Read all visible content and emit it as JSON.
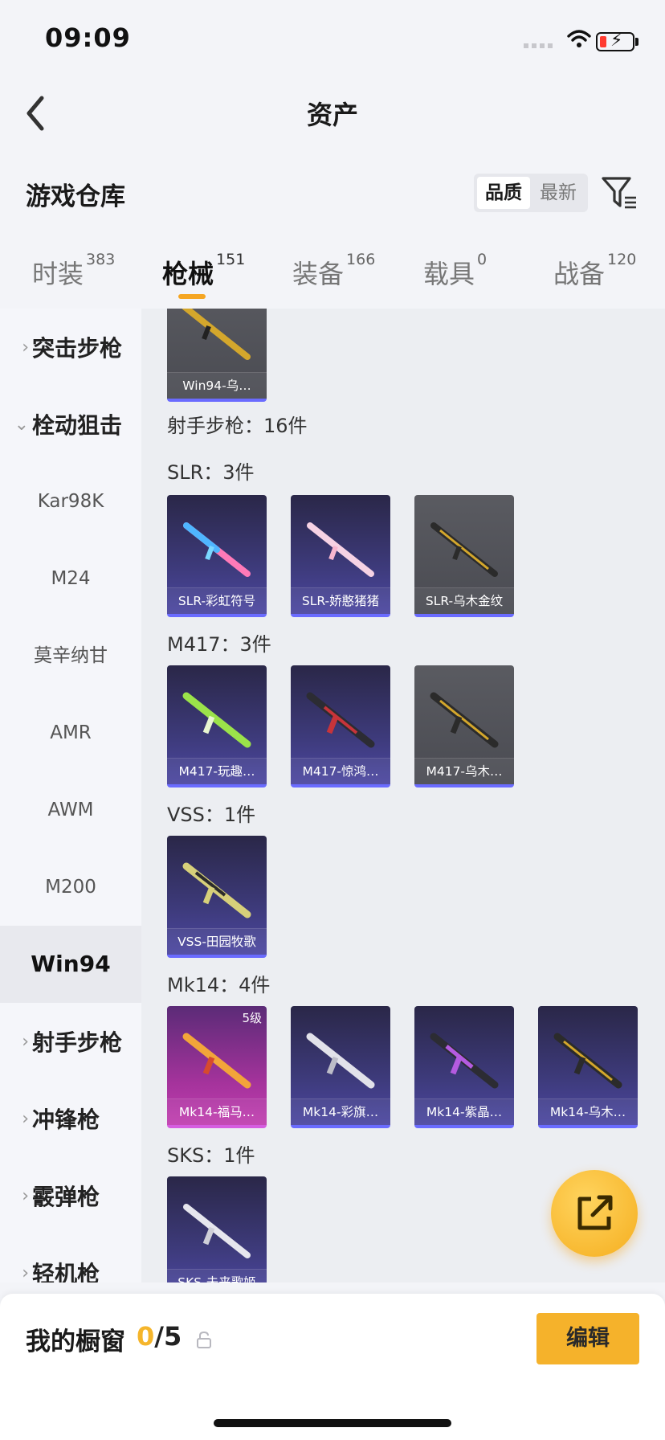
{
  "status_bar": {
    "time": "09:09"
  },
  "nav": {
    "title": "资产"
  },
  "header": {
    "section_title": "游戏仓库",
    "sort_options": [
      "品质",
      "最新"
    ],
    "selected_sort": "品质"
  },
  "tabs": [
    {
      "label": "时装",
      "count": "383"
    },
    {
      "label": "枪械",
      "count": "151",
      "active": true
    },
    {
      "label": "装备",
      "count": "166"
    },
    {
      "label": "载具",
      "count": "0"
    },
    {
      "label": "战备",
      "count": "120"
    }
  ],
  "sidebar": {
    "categories": [
      {
        "label": "突击步枪",
        "expanded": false
      },
      {
        "label": "栓动狙击",
        "expanded": true
      },
      {
        "label": "射手步枪",
        "expanded": false
      },
      {
        "label": "冲锋枪",
        "expanded": false
      },
      {
        "label": "霰弹枪",
        "expanded": false
      },
      {
        "label": "轻机枪",
        "expanded": false
      }
    ],
    "sub_items": [
      "Kar98K",
      "M24",
      "莫辛纳甘",
      "AMR",
      "AWM",
      "M200",
      "Win94"
    ],
    "selected_sub": "Win94"
  },
  "content": {
    "top_card": {
      "name": "Win94-乌…"
    },
    "category_heading": "射手步枪：16件",
    "groups": [
      {
        "heading": "SLR：3件",
        "items": [
          {
            "name": "SLR-彩虹符号",
            "style": "purple"
          },
          {
            "name": "SLR-娇憨猪猪",
            "style": "purple"
          },
          {
            "name": "SLR-乌木金纹",
            "style": "gray"
          }
        ]
      },
      {
        "heading": "M417：3件",
        "items": [
          {
            "name": "M417-玩趣…",
            "style": "purple"
          },
          {
            "name": "M417-惊鸿…",
            "style": "purple"
          },
          {
            "name": "M417-乌木…",
            "style": "gray"
          }
        ]
      },
      {
        "heading": "VSS：1件",
        "items": [
          {
            "name": "VSS-田园牧歌",
            "style": "purple"
          }
        ]
      },
      {
        "heading": "Mk14：4件",
        "items": [
          {
            "name": "Mk14-福马…",
            "style": "pink",
            "level": "5级"
          },
          {
            "name": "Mk14-彩旗…",
            "style": "purple"
          },
          {
            "name": "Mk14-紫晶…",
            "style": "purple"
          },
          {
            "name": "Mk14-乌木…",
            "style": "purple"
          }
        ]
      },
      {
        "heading": "SKS：1件",
        "items": [
          {
            "name": "SKS-未来歌姬",
            "style": "purple"
          }
        ]
      }
    ]
  },
  "bottom_bar": {
    "label": "我的橱窗",
    "count_used": "0",
    "count_total": "/5",
    "edit_label": "编辑"
  },
  "colors": {
    "accent": "#f5a623",
    "card_purple": "#3d3a7a",
    "card_pink": "#a5339c"
  }
}
